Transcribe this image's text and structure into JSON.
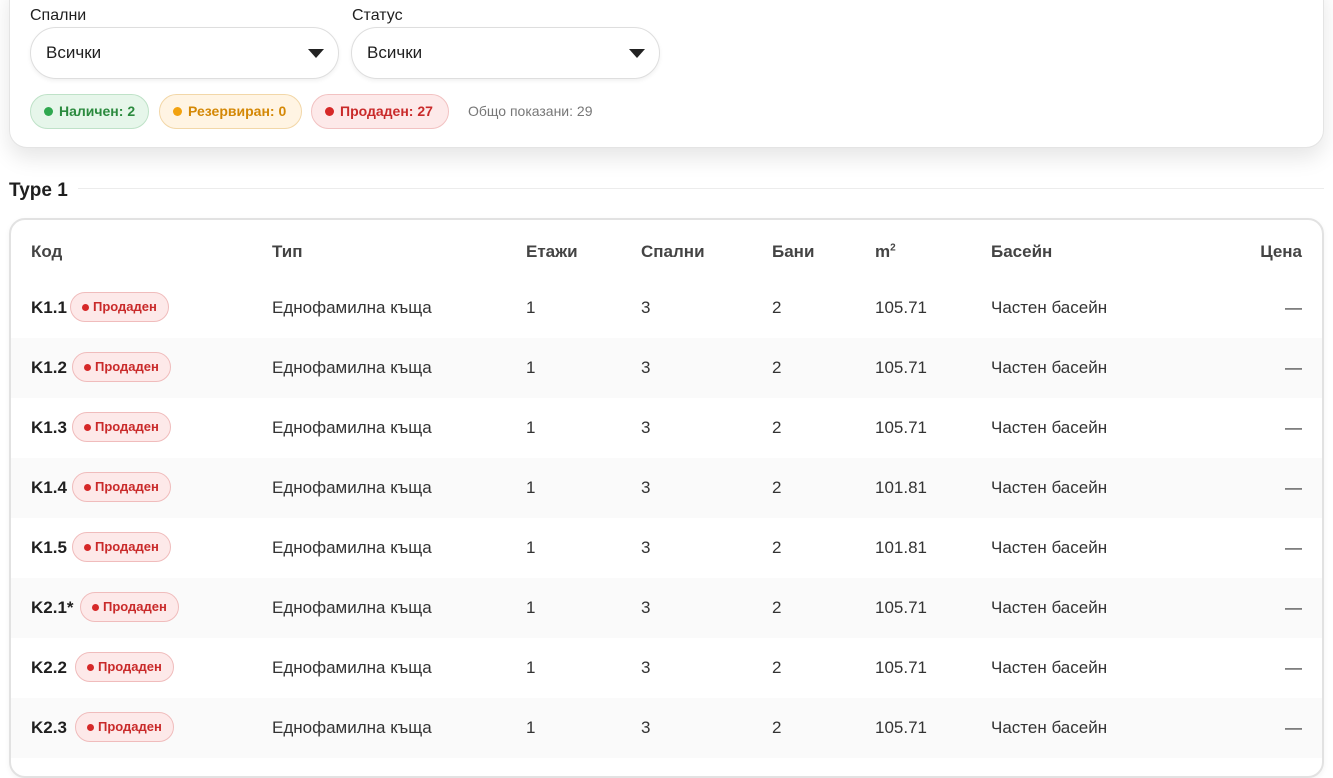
{
  "filters": {
    "bedrooms": {
      "label": "Спални",
      "value": "Всички"
    },
    "status": {
      "label": "Статус",
      "value": "Всички"
    }
  },
  "chips": [
    {
      "label": "Наличен: 2",
      "color": "#2fa84f"
    },
    {
      "label": "Резервиран: 0",
      "color": "#f2a20f"
    },
    {
      "label": "Продаден: 27",
      "color": "#d62828"
    }
  ],
  "total_label": "Общо показани: 29",
  "section": {
    "title": "Type 1"
  },
  "table": {
    "headers": {
      "code": "Код",
      "type": "Тип",
      "floors": "Етажи",
      "bedrooms": "Спални",
      "baths": "Бани",
      "area": "m",
      "area_sup": "2",
      "pool": "Басейн",
      "price": "Цена"
    },
    "rows": [
      {
        "code": "K1.1",
        "status": "Продаден",
        "type": "Еднофамилна къща",
        "floors": "1",
        "bedrooms": "3",
        "baths": "2",
        "area": "105.71",
        "pool": "Частен басейн",
        "price": "—"
      },
      {
        "code": "K1.2",
        "status": "Продаден",
        "type": "Еднофамилна къща",
        "floors": "1",
        "bedrooms": "3",
        "baths": "2",
        "area": "105.71",
        "pool": "Частен басейн",
        "price": "—"
      },
      {
        "code": "K1.3",
        "status": "Продаден",
        "type": "Еднофамилна къща",
        "floors": "1",
        "bedrooms": "3",
        "baths": "2",
        "area": "105.71",
        "pool": "Частен басейн",
        "price": "—"
      },
      {
        "code": "K1.4",
        "status": "Продаден",
        "type": "Еднофамилна къща",
        "floors": "1",
        "bedrooms": "3",
        "baths": "2",
        "area": "101.81",
        "pool": "Частен басейн",
        "price": "—"
      },
      {
        "code": "K1.5",
        "status": "Продаден",
        "type": "Еднофамилна къща",
        "floors": "1",
        "bedrooms": "3",
        "baths": "2",
        "area": "101.81",
        "pool": "Частен басейн",
        "price": "—"
      },
      {
        "code": "K2.1*",
        "status": "Продаден",
        "type": "Еднофамилна къща",
        "floors": "1",
        "bedrooms": "3",
        "baths": "2",
        "area": "105.71",
        "pool": "Частен басейн",
        "price": "—"
      },
      {
        "code": "K2.2",
        "status": "Продаден",
        "type": "Еднофамилна къща",
        "floors": "1",
        "bedrooms": "3",
        "baths": "2",
        "area": "105.71",
        "pool": "Частен басейн",
        "price": "—"
      },
      {
        "code": "K2.3",
        "status": "Продаден",
        "type": "Еднофамилна къща",
        "floors": "1",
        "bedrooms": "3",
        "baths": "2",
        "area": "105.71",
        "pool": "Частен басейн",
        "price": "—"
      }
    ]
  }
}
